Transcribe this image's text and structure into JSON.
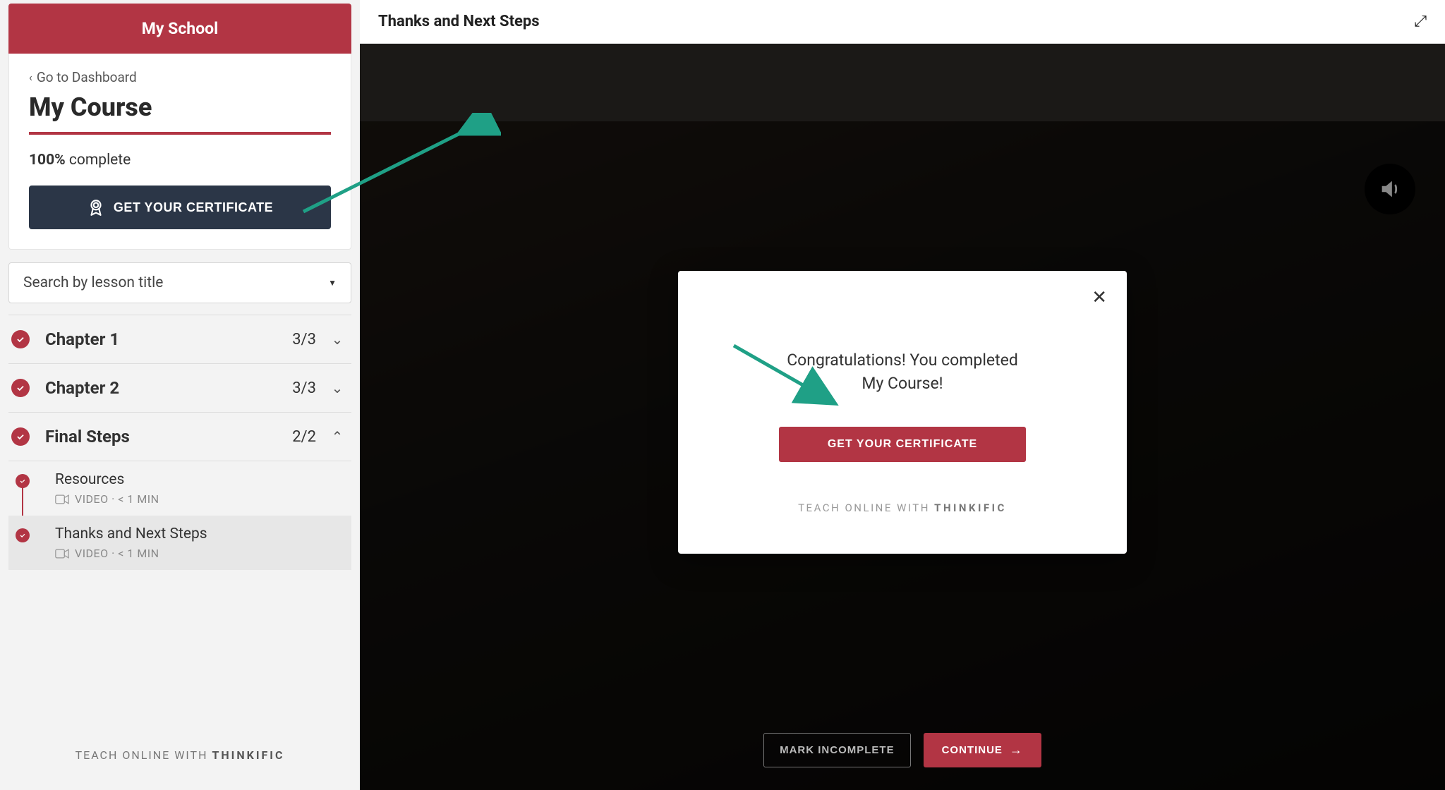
{
  "sidebar": {
    "school_name": "My School",
    "back_label": "Go to Dashboard",
    "course_title": "My Course",
    "progress_pct": "100%",
    "progress_word": "complete",
    "cert_button": "GET YOUR CERTIFICATE",
    "search_placeholder": "Search by lesson title",
    "chapters": [
      {
        "name": "Chapter 1",
        "count": "3/3",
        "expanded": false
      },
      {
        "name": "Chapter 2",
        "count": "3/3",
        "expanded": false
      },
      {
        "name": "Final Steps",
        "count": "2/2",
        "expanded": true
      }
    ],
    "lessons": [
      {
        "title": "Resources",
        "meta": "VIDEO · < 1 MIN",
        "active": false
      },
      {
        "title": "Thanks and Next Steps",
        "meta": "VIDEO · < 1 MIN",
        "active": true
      }
    ],
    "footer_prefix": "TEACH ONLINE WITH ",
    "footer_brand": "THINKIFIC"
  },
  "main": {
    "topbar_title": "Thanks and Next Steps",
    "modal": {
      "message": "Congratulations! You completed My Course!",
      "cert_button": "GET YOUR CERTIFICATE",
      "footer_prefix": "TEACH ONLINE WITH ",
      "footer_brand": "THINKIFIC"
    },
    "bottom": {
      "mark_incomplete": "MARK INCOMPLETE",
      "continue": "CONTINUE"
    }
  }
}
